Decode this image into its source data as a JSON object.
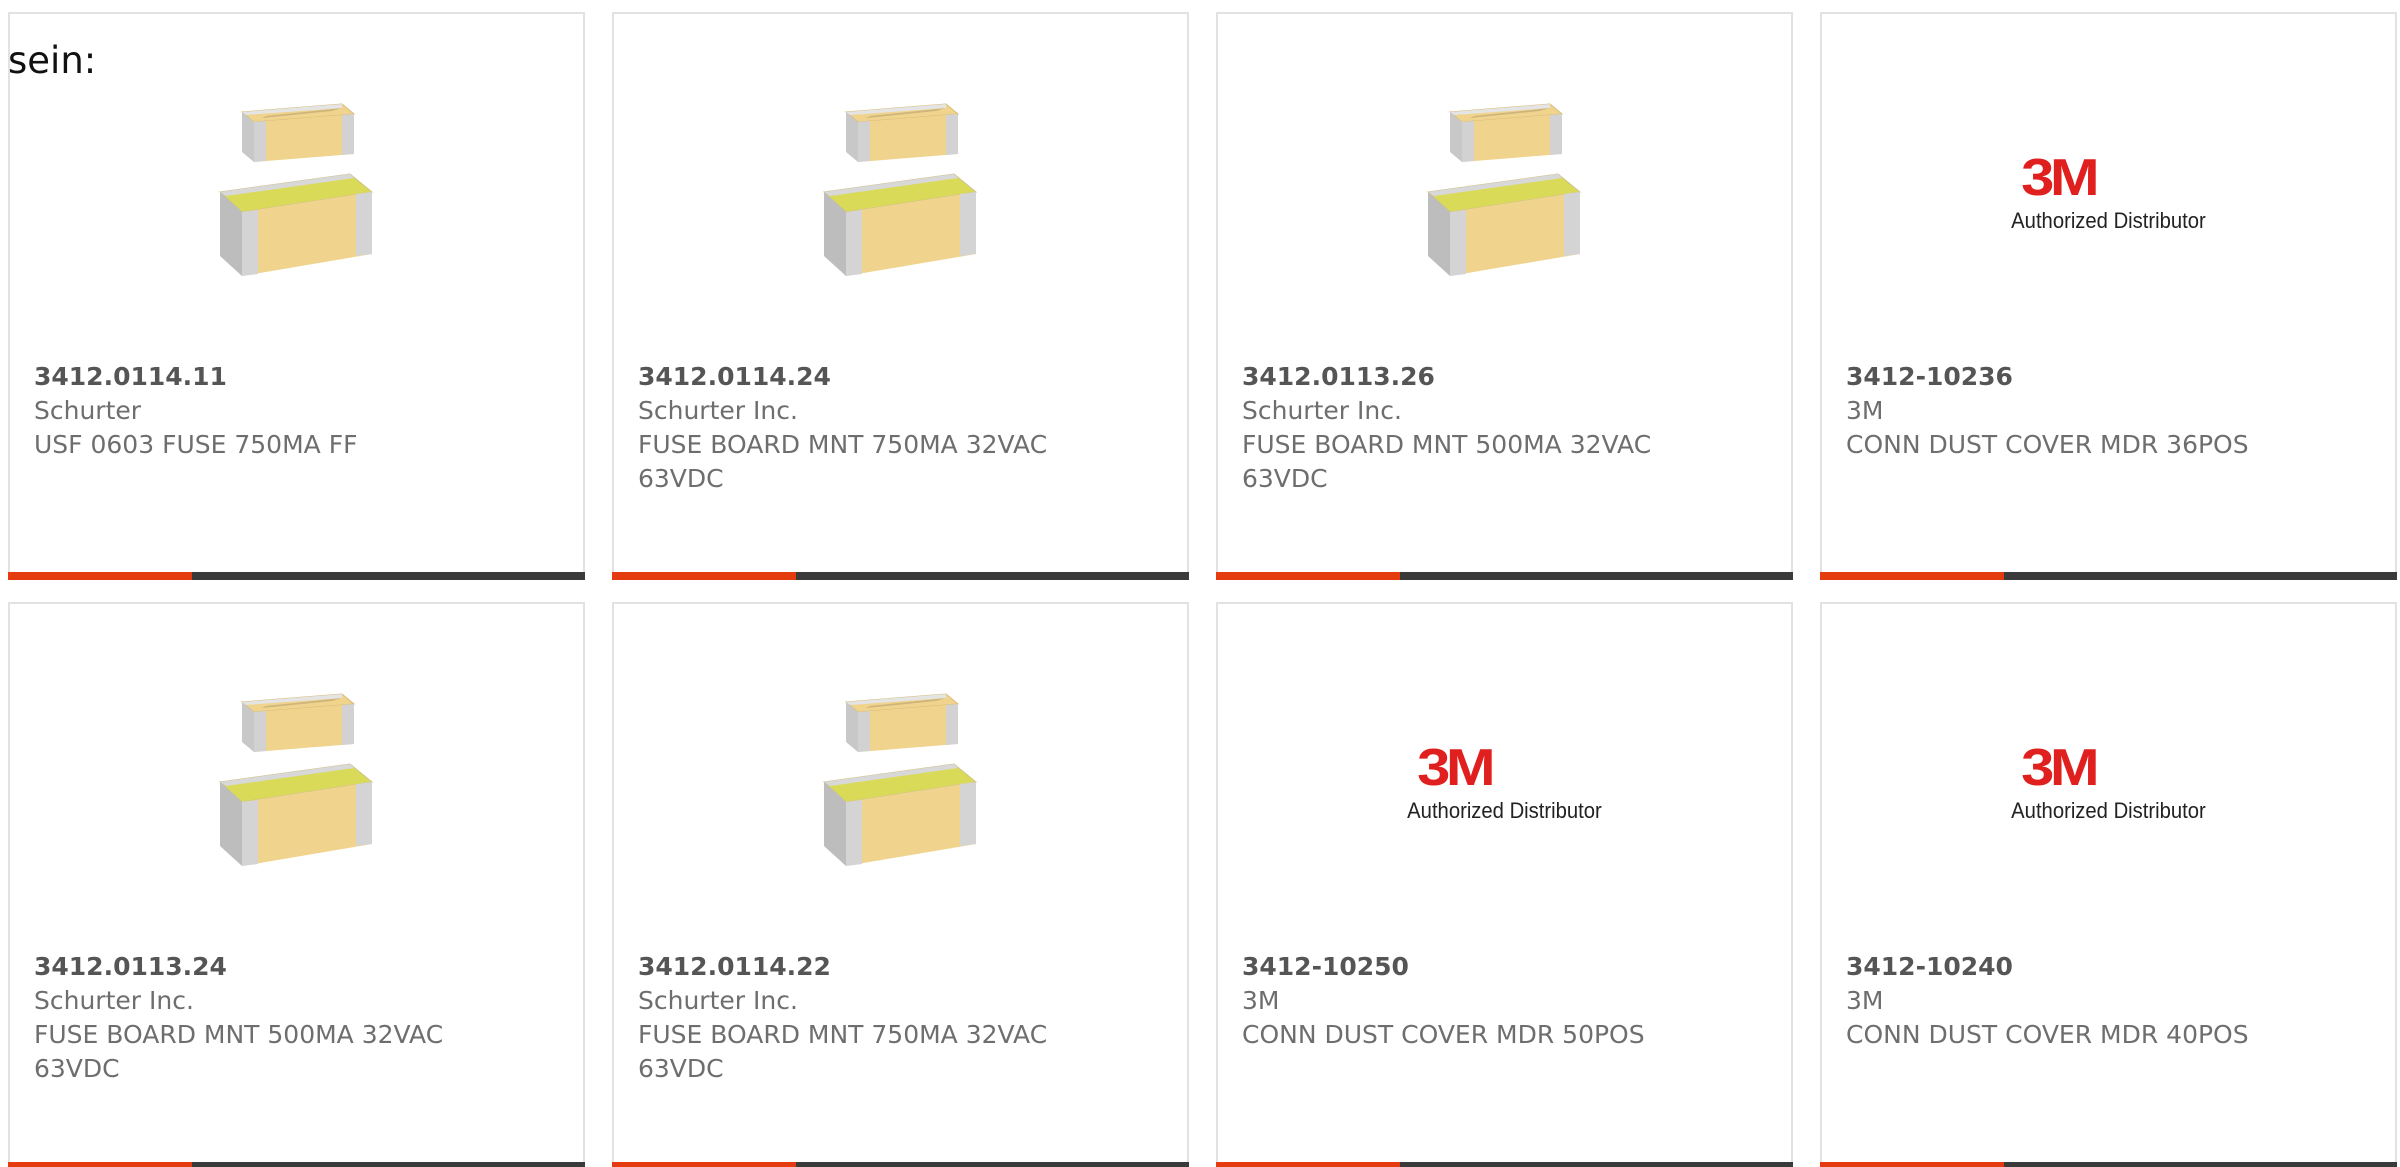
{
  "lead_text": "sein:",
  "colors": {
    "accent": "#e63b0e",
    "bar": "#3a3a3a",
    "logo_red": "#e0201e",
    "fuse_top": "#f0d48d",
    "fuse_pad": "#d9db58",
    "fuse_cap": "#c8c8c8"
  },
  "logo_3m": {
    "mark": "3M",
    "tagline": "Authorized Distributor"
  },
  "products": [
    {
      "part_number": "3412.0114.11",
      "manufacturer": "Schurter",
      "description": "USF 0603 FUSE 750MA FF",
      "image": "fuse-chip-image"
    },
    {
      "part_number": "3412.0114.24",
      "manufacturer": "Schurter Inc.",
      "description": "FUSE BOARD MNT 750MA 32VAC 63VDC",
      "image": "fuse-chip-image"
    },
    {
      "part_number": "3412.0113.26",
      "manufacturer": "Schurter Inc.",
      "description": "FUSE BOARD MNT 500MA 32VAC 63VDC",
      "image": "fuse-chip-image"
    },
    {
      "part_number": "3412-10236",
      "manufacturer": "3M",
      "description": "CONN DUST COVER MDR 36POS",
      "image": "3m-logo"
    },
    {
      "part_number": "3412.0113.24",
      "manufacturer": "Schurter Inc.",
      "description": "FUSE BOARD MNT 500MA 32VAC 63VDC",
      "image": "fuse-chip-image"
    },
    {
      "part_number": "3412.0114.22",
      "manufacturer": "Schurter Inc.",
      "description": "FUSE BOARD MNT 750MA 32VAC 63VDC",
      "image": "fuse-chip-image"
    },
    {
      "part_number": "3412-10250",
      "manufacturer": "3M",
      "description": "CONN DUST COVER MDR 50POS",
      "image": "3m-logo"
    },
    {
      "part_number": "3412-10240",
      "manufacturer": "3M",
      "description": "CONN DUST COVER MDR 40POS",
      "image": "3m-logo"
    }
  ]
}
